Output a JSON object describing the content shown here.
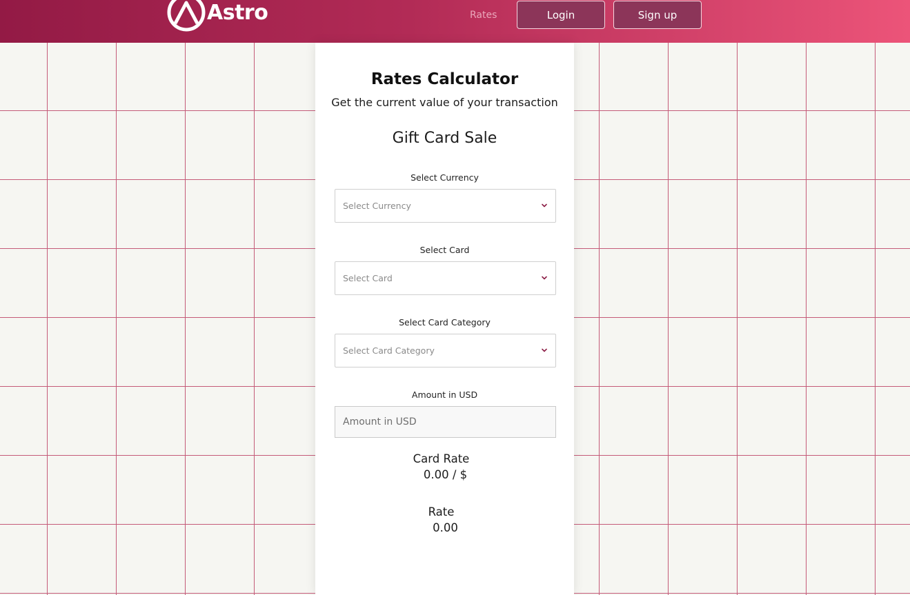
{
  "header": {
    "brand": "Astro",
    "nav_rates": "Rates",
    "login_label": "Login",
    "signup_label": "Sign up"
  },
  "calculator": {
    "title": "Rates Calculator",
    "subtitle": "Get the current value of your transaction",
    "section_title": "Gift Card Sale",
    "currency_label": "Select Currency",
    "currency_placeholder": "Select Currency",
    "card_label": "Select Card",
    "card_placeholder": "Select Card",
    "category_label": "Select Card Category",
    "category_placeholder": "Select Card Category",
    "amount_label": "Amount in USD",
    "amount_placeholder": "Amount in USD",
    "card_rate_label": "Card Rate",
    "card_rate_value": "0.00 / $",
    "rate_label": "Rate",
    "rate_value": "0.00"
  },
  "colors": {
    "header_start": "#931a45",
    "header_end": "#ec5479",
    "button_bg": "#8c3559",
    "grid_line": "#c45a78",
    "page_bg": "#f6f6f2",
    "chevron": "#8c1f47"
  },
  "icons": {
    "logo": "astro-logo-icon",
    "dropdown": "chevron-down-icon"
  }
}
